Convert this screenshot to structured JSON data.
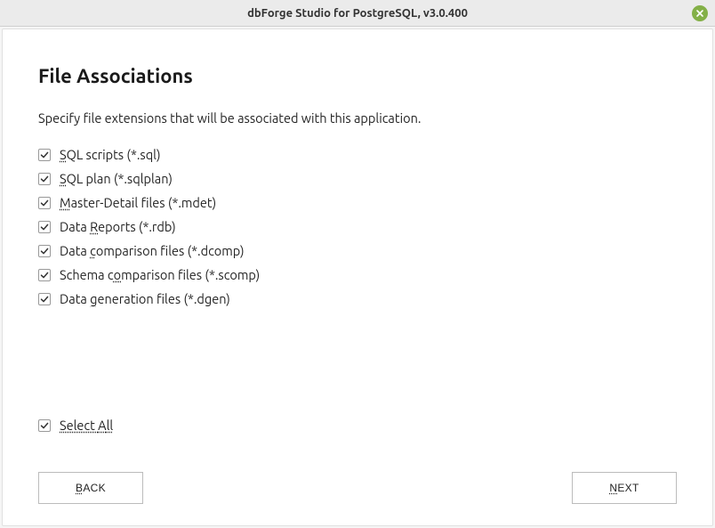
{
  "titlebar": {
    "title": "dbForge Studio for PostgreSQL, v3.0.400"
  },
  "page": {
    "heading": "File Associations",
    "description": "Specify file extensions that will be associated with this application."
  },
  "items": [
    {
      "pre": "",
      "accel": "S",
      "post": "QL scripts (*.sql)",
      "checked": true
    },
    {
      "pre": "",
      "accel": "S",
      "post": "QL plan (*.sqlplan)",
      "checked": true
    },
    {
      "pre": "",
      "accel": "M",
      "post": "aster-Detail files (*.mdet)",
      "checked": true
    },
    {
      "pre": "Data ",
      "accel": "R",
      "post": "eports (*.rdb)",
      "checked": true
    },
    {
      "pre": "Data ",
      "accel": "c",
      "post": "omparison files (*.dcomp)",
      "checked": true
    },
    {
      "pre": "Schema c",
      "accel": "o",
      "post": "mparison files (*.scomp)",
      "checked": true
    },
    {
      "pre": "Data ",
      "accel": "g",
      "post": "eneration files (*.dgen)",
      "checked": true
    }
  ],
  "selectAll": {
    "pre": "Select ",
    "accel": "A",
    "post": "ll",
    "checked": true
  },
  "buttons": {
    "back": {
      "pre": "",
      "accel": "B",
      "post": "ACK"
    },
    "next": {
      "pre": "",
      "accel": "N",
      "post": "EXT"
    }
  }
}
